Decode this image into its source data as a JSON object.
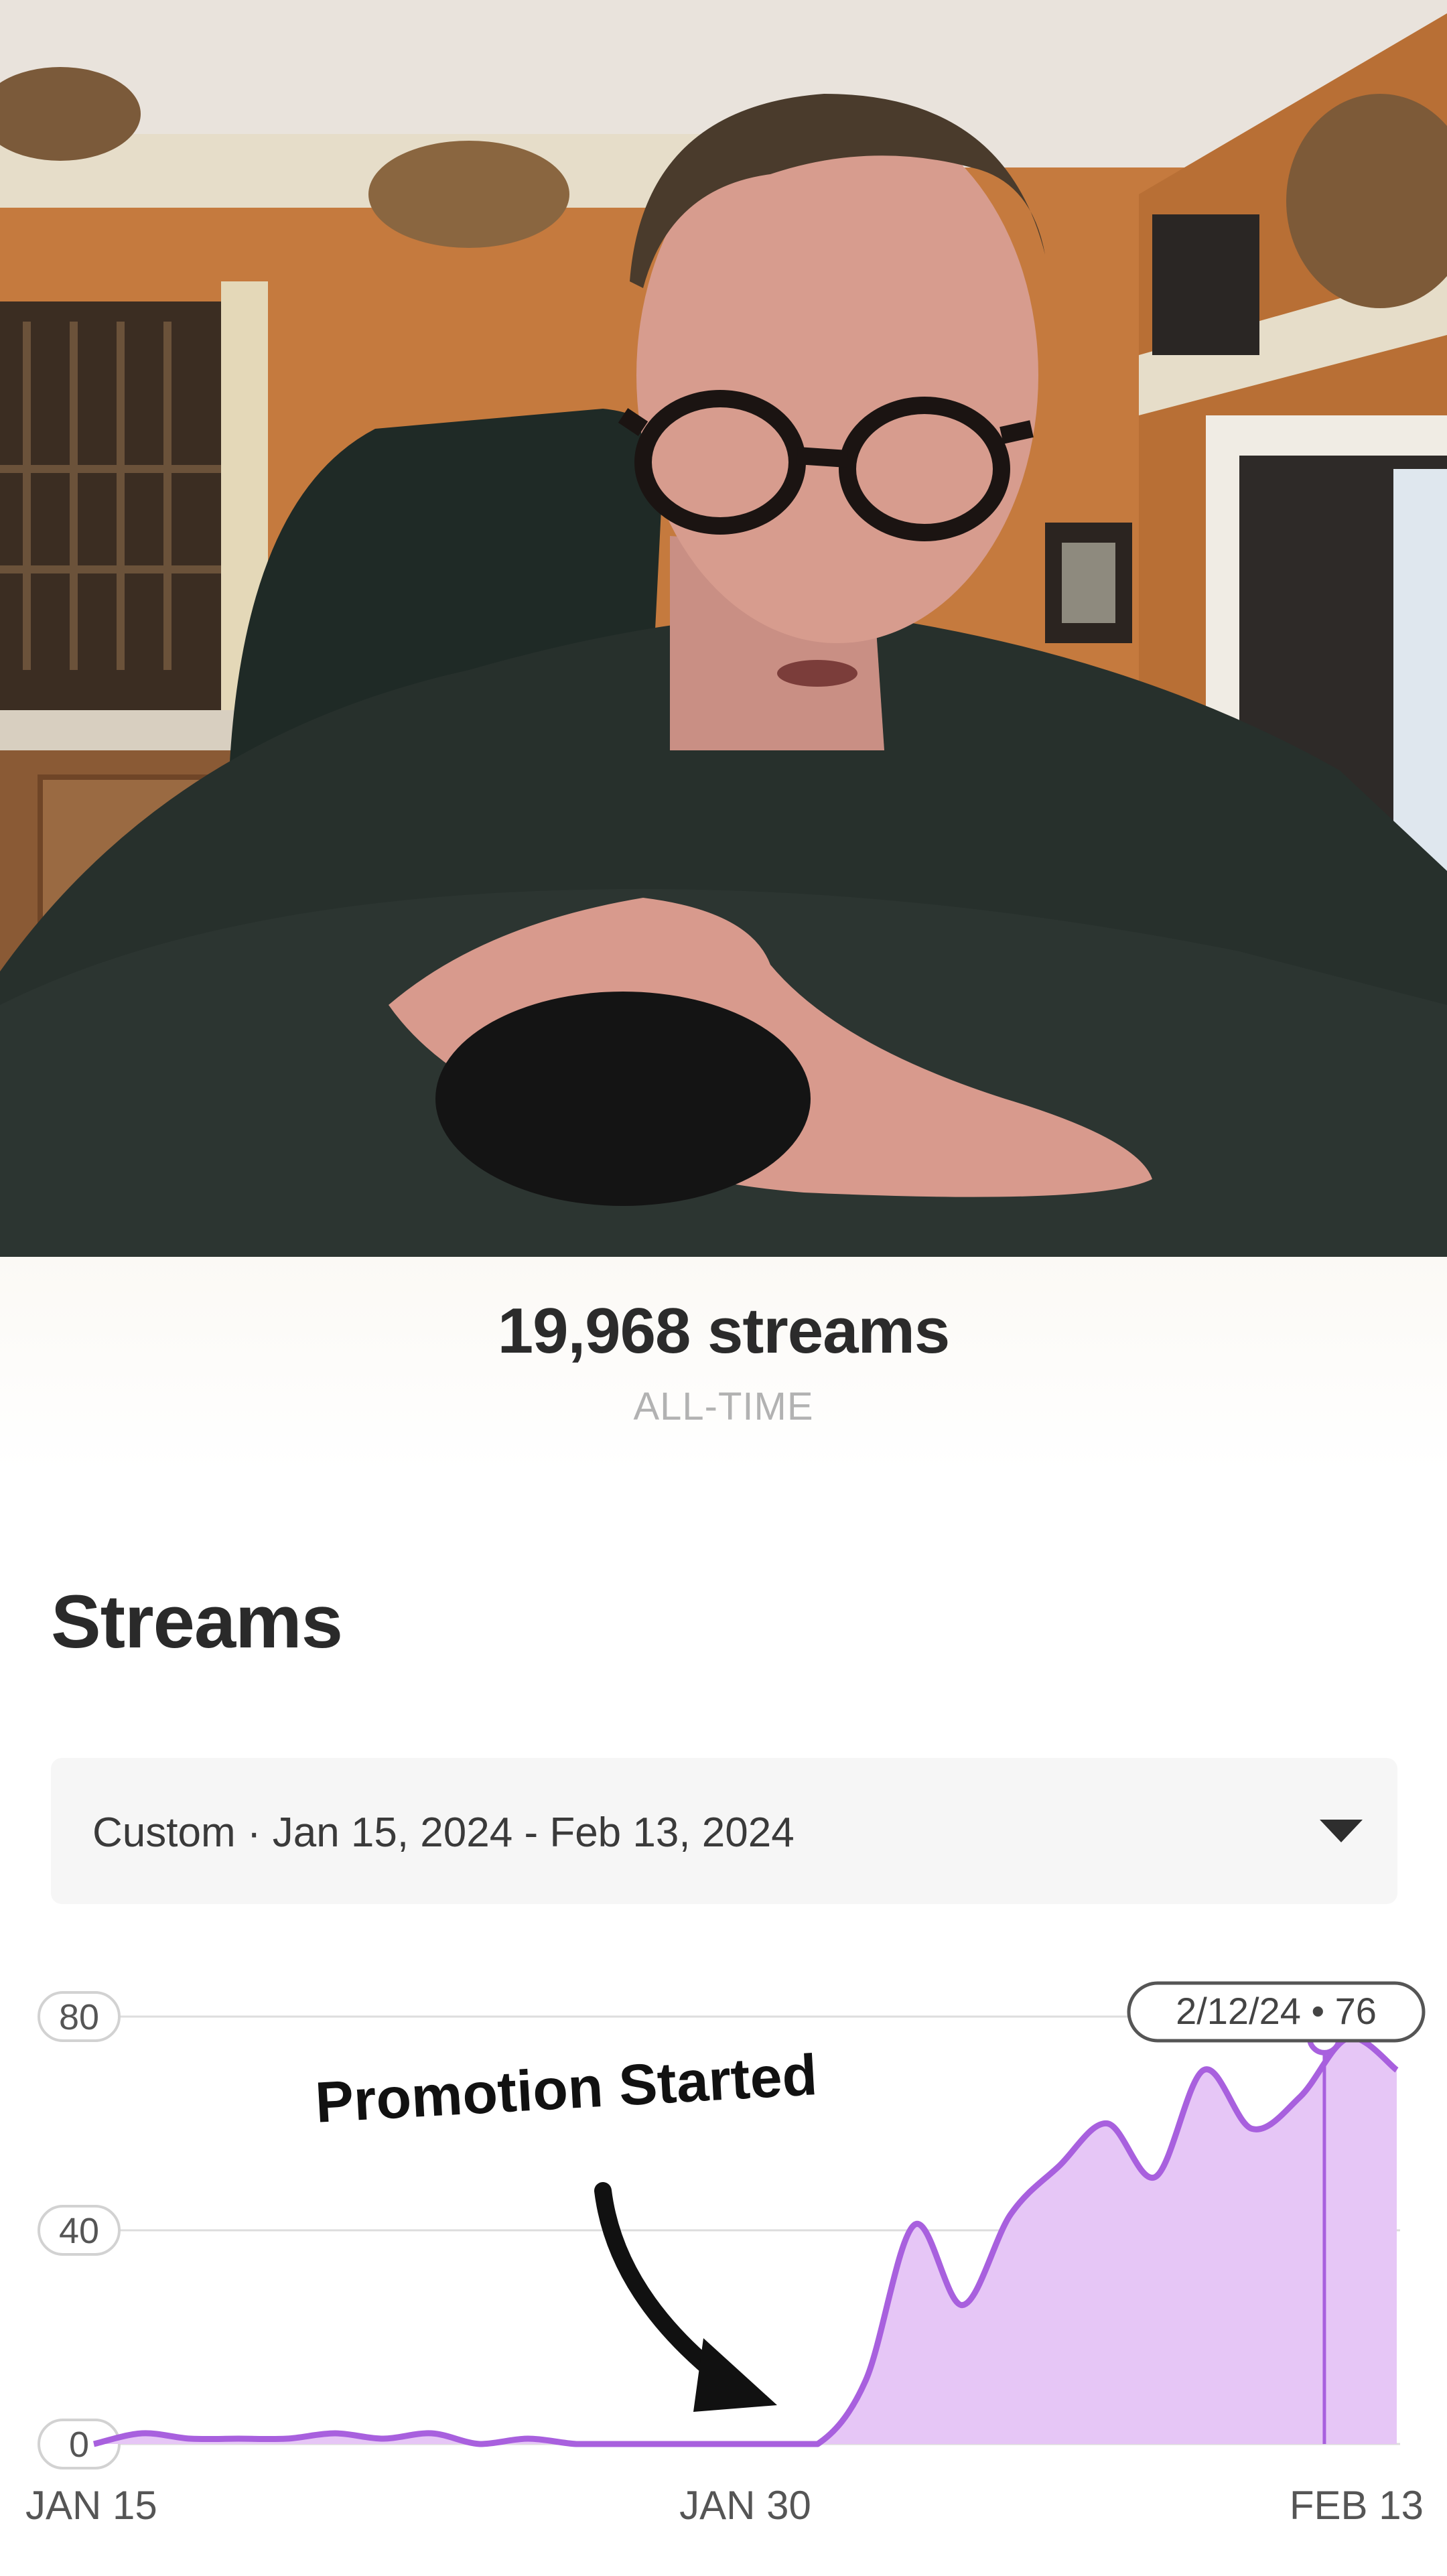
{
  "video": {
    "description_icon": "video-frame"
  },
  "stats": {
    "total_streams": "19,968 streams",
    "caption": "ALL-TIME"
  },
  "streams_section": {
    "title": "Streams",
    "date_range_select": {
      "selected": "Custom · Jan 15, 2024 - Feb 13, 2024",
      "icon": "caret-down-icon"
    }
  },
  "annotation": {
    "text": "Promotion Started",
    "icon": "curved-arrow-icon"
  },
  "chart_data": {
    "type": "area",
    "x_tick_labels": [
      "JAN 15",
      "JAN 30",
      "FEB 13"
    ],
    "y_tick_labels": [
      "0",
      "40",
      "80"
    ],
    "ylim": [
      0,
      80
    ],
    "grid": true,
    "color": "#a860de",
    "fill_color": "#e6c6f6",
    "series": [
      {
        "values": [
          0,
          2,
          1,
          1,
          1,
          2,
          1,
          2,
          0,
          1,
          0,
          0,
          0,
          0,
          0,
          0,
          12,
          41,
          26,
          43,
          52,
          60,
          50,
          70,
          59,
          65,
          76,
          70
        ]
      }
    ],
    "x_indices_labels": [
      0,
      13.5,
      27
    ],
    "tooltip": {
      "text": "2/12/24 • 76",
      "index": 25.5,
      "value": 76
    }
  }
}
